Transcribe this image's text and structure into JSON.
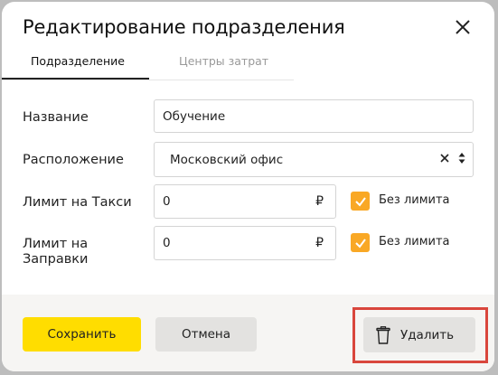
{
  "dialog": {
    "title": "Редактирование подразделения",
    "tabs": [
      {
        "label": "Подразделение",
        "active": true
      },
      {
        "label": "Центры затрат",
        "active": false
      }
    ]
  },
  "form": {
    "name": {
      "label": "Название",
      "value": "Обучение"
    },
    "location": {
      "label": "Расположение",
      "value": "Московский офис"
    },
    "taxi_limit": {
      "label": "Лимит на Такси",
      "value": "0",
      "currency": "₽",
      "no_limit_label": "Без лимита",
      "no_limit_checked": true
    },
    "fuel_limit": {
      "label_line1": "Лимит на",
      "label_line2": "Заправки",
      "value": "0",
      "currency": "₽",
      "no_limit_label": "Без лимита",
      "no_limit_checked": true
    }
  },
  "footer": {
    "save_label": "Сохранить",
    "cancel_label": "Отмена",
    "delete_label": "Удалить"
  },
  "colors": {
    "accent_yellow": "#ffdd00",
    "checkbox_orange": "#f9a825",
    "highlight_red": "#d9463c"
  },
  "icons": [
    "close-icon",
    "clear-icon",
    "sort-arrows-icon",
    "checkmark-icon",
    "trash-icon"
  ]
}
